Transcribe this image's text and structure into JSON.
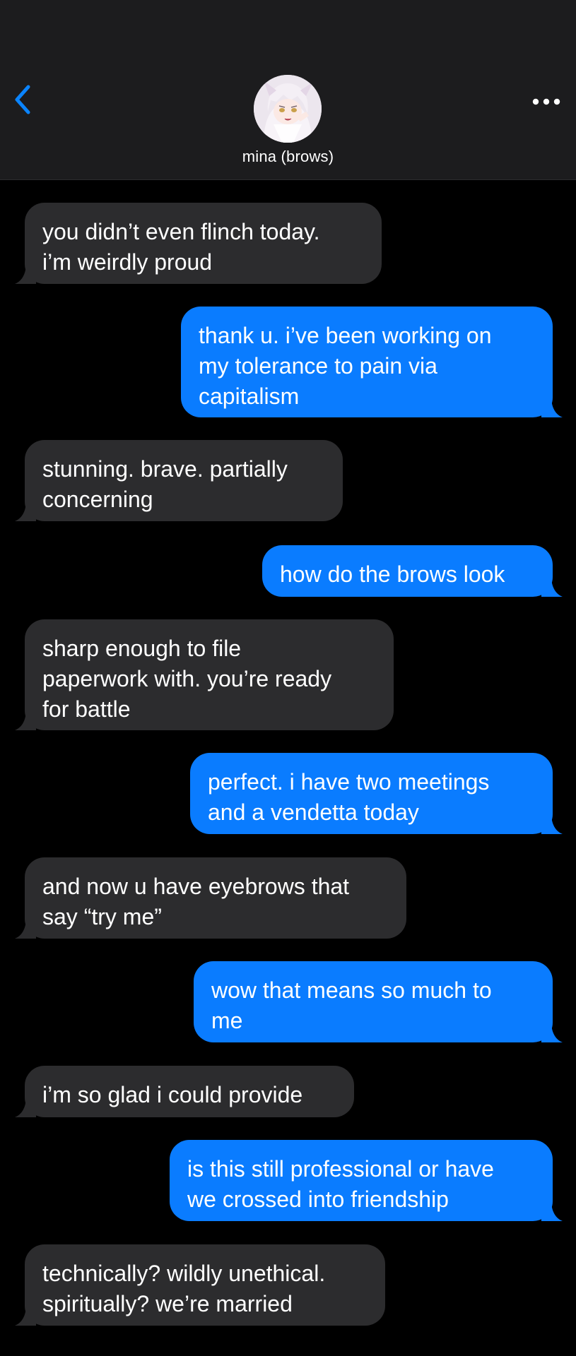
{
  "header": {
    "contact_name": "mina (brows)",
    "back_icon": "chevron-left-icon",
    "more_icon": "ellipsis-icon",
    "accent_color": "#0a84ff"
  },
  "colors": {
    "received_bubble": "#2c2c2e",
    "sent_bubble": "#0a7cff",
    "background": "#000000",
    "header_background": "#1c1c1e"
  },
  "messages": [
    {
      "direction": "received",
      "lines": [
        "you didn’t even flinch today.",
        "i’m weirdly proud"
      ]
    },
    {
      "direction": "sent",
      "lines": [
        "thank u. i’ve been working on",
        "my tolerance to pain via",
        "capitalism"
      ]
    },
    {
      "direction": "received",
      "lines": [
        "stunning. brave. partially",
        "concerning"
      ]
    },
    {
      "direction": "sent",
      "lines": [
        "how do the brows look"
      ]
    },
    {
      "direction": "received",
      "lines": [
        "sharp enough to file",
        "paperwork with. you’re ready",
        "for battle"
      ]
    },
    {
      "direction": "sent",
      "lines": [
        "perfect. i have two meetings",
        "and a vendetta today"
      ]
    },
    {
      "direction": "received",
      "lines": [
        "and now u have eyebrows that",
        "say “try me”"
      ]
    },
    {
      "direction": "sent",
      "lines": [
        "wow that means so much to",
        "me"
      ]
    },
    {
      "direction": "received",
      "lines": [
        "i’m so glad i could provide"
      ]
    },
    {
      "direction": "sent",
      "lines": [
        "is this still professional or have",
        "we crossed into friendship"
      ]
    },
    {
      "direction": "received",
      "lines": [
        "technically? wildly unethical.",
        "spiritually? we’re married"
      ]
    }
  ]
}
